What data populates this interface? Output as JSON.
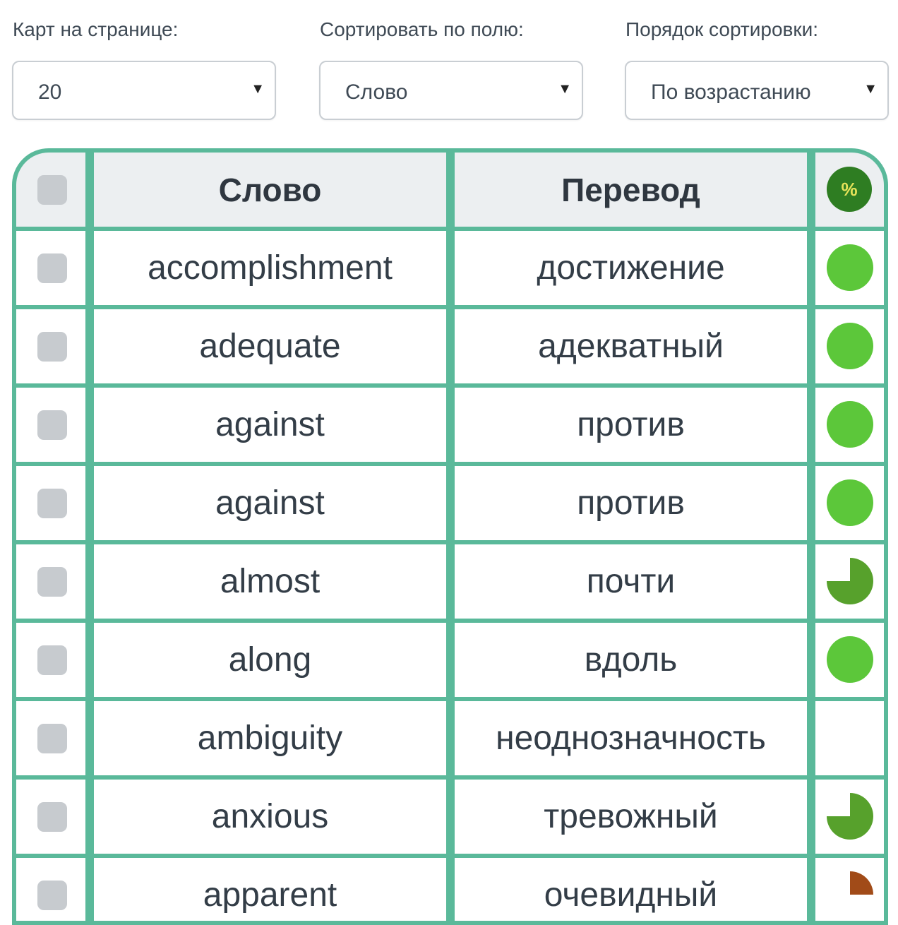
{
  "controls": [
    {
      "label": "Карт на странице:",
      "value": "20",
      "arrow": "▼"
    },
    {
      "label": "Сортировать по полю:",
      "value": "Слово",
      "arrow": "▼"
    },
    {
      "label": "Порядок сортировки:",
      "value": "По возрастанию",
      "arrow": "▼"
    }
  ],
  "table": {
    "headers": {
      "word": "Слово",
      "translation": "Перевод",
      "progress_icon": "%"
    },
    "rows": [
      {
        "word": "accomplishment",
        "translation": "достижение",
        "progress": 1.0,
        "color": "#5cc73a"
      },
      {
        "word": "adequate",
        "translation": "адекватный",
        "progress": 1.0,
        "color": "#5cc73a"
      },
      {
        "word": "against",
        "translation": "против",
        "progress": 1.0,
        "color": "#5cc73a"
      },
      {
        "word": "against",
        "translation": "против",
        "progress": 1.0,
        "color": "#5cc73a"
      },
      {
        "word": "almost",
        "translation": "почти",
        "progress": 0.75,
        "color": "#57a12c"
      },
      {
        "word": "along",
        "translation": "вдоль",
        "progress": 1.0,
        "color": "#5cc73a"
      },
      {
        "word": "ambiguity",
        "translation": "неоднозначность",
        "progress": 0,
        "color": "#5cc73a"
      },
      {
        "word": "anxious",
        "translation": "тревожный",
        "progress": 0.75,
        "color": "#57a12c"
      },
      {
        "word": "apparent",
        "translation": "очевидный",
        "progress": 0.25,
        "color": "#a14b18"
      }
    ]
  }
}
